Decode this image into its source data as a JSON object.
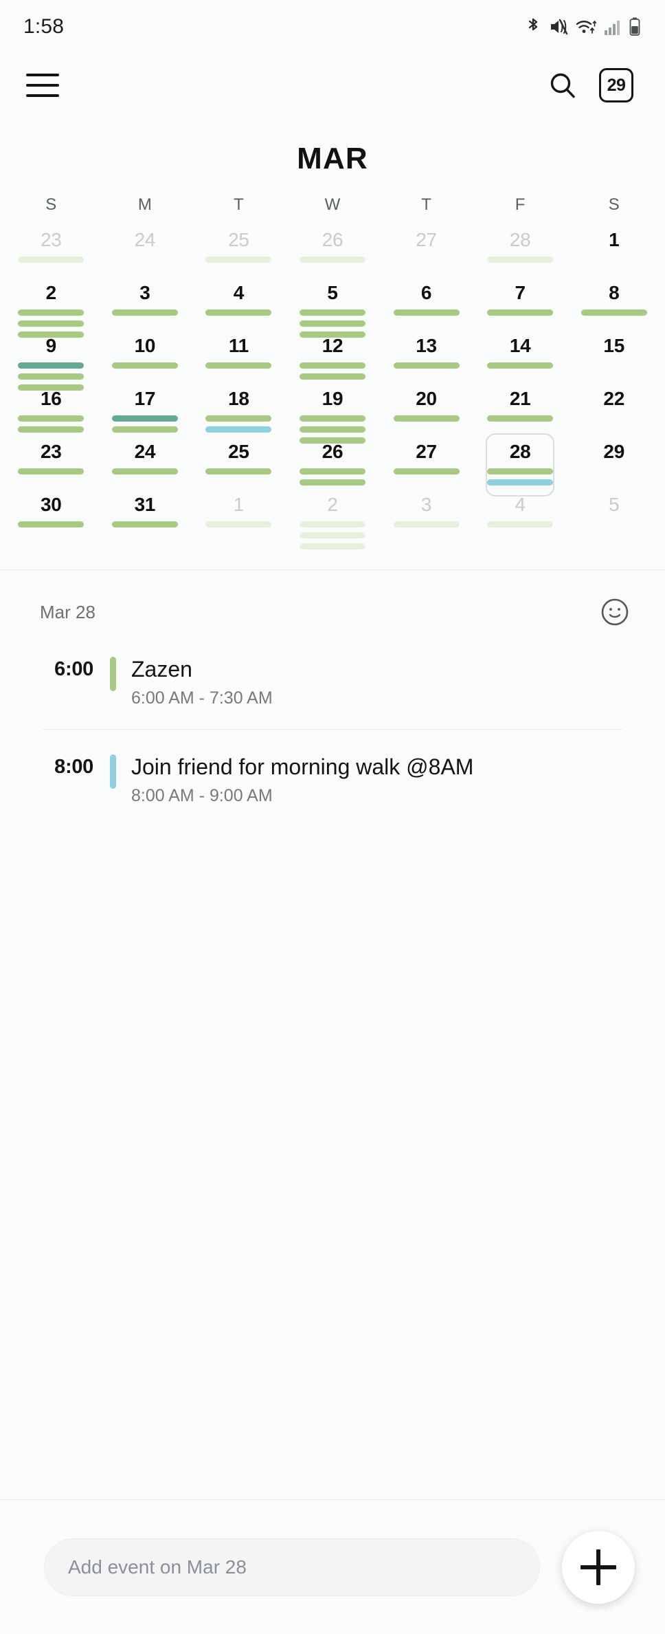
{
  "status": {
    "time": "1:58",
    "icons": [
      "bluetooth-icon",
      "mute-icon",
      "wifi-icon",
      "signal-icon",
      "battery-icon"
    ]
  },
  "toolbar": {
    "menu_label": "menu",
    "search_label": "search",
    "today_badge": "29"
  },
  "header": {
    "month": "MAR"
  },
  "calendar": {
    "weekday_headers": [
      "S",
      "M",
      "T",
      "W",
      "T",
      "F",
      "S"
    ],
    "colors": {
      "green": "#a8c981",
      "teal": "#62ab91",
      "blue": "#8fcfdf",
      "green_faded": "#e7f0dd",
      "selected_border": "#dcdcdc"
    },
    "weeks": [
      [
        {
          "num": "23",
          "other": true,
          "selected": false,
          "bars": [
            "green_faded"
          ]
        },
        {
          "num": "24",
          "other": true,
          "selected": false,
          "bars": []
        },
        {
          "num": "25",
          "other": true,
          "selected": false,
          "bars": [
            "green_faded"
          ]
        },
        {
          "num": "26",
          "other": true,
          "selected": false,
          "bars": [
            "green_faded"
          ]
        },
        {
          "num": "27",
          "other": true,
          "selected": false,
          "bars": []
        },
        {
          "num": "28",
          "other": true,
          "selected": false,
          "bars": [
            "green_faded"
          ]
        },
        {
          "num": "1",
          "other": false,
          "selected": false,
          "bars": []
        }
      ],
      [
        {
          "num": "2",
          "other": false,
          "selected": false,
          "bars": [
            "green",
            "green",
            "green"
          ]
        },
        {
          "num": "3",
          "other": false,
          "selected": false,
          "bars": [
            "green"
          ]
        },
        {
          "num": "4",
          "other": false,
          "selected": false,
          "bars": [
            "green"
          ]
        },
        {
          "num": "5",
          "other": false,
          "selected": false,
          "bars": [
            "green",
            "green",
            "green"
          ]
        },
        {
          "num": "6",
          "other": false,
          "selected": false,
          "bars": [
            "green"
          ]
        },
        {
          "num": "7",
          "other": false,
          "selected": false,
          "bars": [
            "green"
          ]
        },
        {
          "num": "8",
          "other": false,
          "selected": false,
          "bars": [
            "green"
          ]
        }
      ],
      [
        {
          "num": "9",
          "other": false,
          "selected": false,
          "bars": [
            "teal",
            "green",
            "green"
          ]
        },
        {
          "num": "10",
          "other": false,
          "selected": false,
          "bars": [
            "green"
          ]
        },
        {
          "num": "11",
          "other": false,
          "selected": false,
          "bars": [
            "green"
          ]
        },
        {
          "num": "12",
          "other": false,
          "selected": false,
          "bars": [
            "green",
            "green"
          ]
        },
        {
          "num": "13",
          "other": false,
          "selected": false,
          "bars": [
            "green"
          ]
        },
        {
          "num": "14",
          "other": false,
          "selected": false,
          "bars": [
            "green"
          ]
        },
        {
          "num": "15",
          "other": false,
          "selected": false,
          "bars": []
        }
      ],
      [
        {
          "num": "16",
          "other": false,
          "selected": false,
          "bars": [
            "green",
            "green"
          ]
        },
        {
          "num": "17",
          "other": false,
          "selected": false,
          "bars": [
            "teal",
            "green"
          ]
        },
        {
          "num": "18",
          "other": false,
          "selected": false,
          "bars": [
            "green",
            "blue"
          ]
        },
        {
          "num": "19",
          "other": false,
          "selected": false,
          "bars": [
            "green",
            "green",
            "green"
          ]
        },
        {
          "num": "20",
          "other": false,
          "selected": false,
          "bars": [
            "green"
          ]
        },
        {
          "num": "21",
          "other": false,
          "selected": false,
          "bars": [
            "green"
          ]
        },
        {
          "num": "22",
          "other": false,
          "selected": false,
          "bars": []
        }
      ],
      [
        {
          "num": "23",
          "other": false,
          "selected": false,
          "bars": [
            "green"
          ]
        },
        {
          "num": "24",
          "other": false,
          "selected": false,
          "bars": [
            "green"
          ]
        },
        {
          "num": "25",
          "other": false,
          "selected": false,
          "bars": [
            "green"
          ]
        },
        {
          "num": "26",
          "other": false,
          "selected": false,
          "bars": [
            "green",
            "green"
          ]
        },
        {
          "num": "27",
          "other": false,
          "selected": false,
          "bars": [
            "green"
          ]
        },
        {
          "num": "28",
          "other": false,
          "selected": true,
          "bars": [
            "green",
            "blue"
          ]
        },
        {
          "num": "29",
          "other": false,
          "selected": false,
          "bars": []
        }
      ],
      [
        {
          "num": "30",
          "other": false,
          "selected": false,
          "bars": [
            "green"
          ]
        },
        {
          "num": "31",
          "other": false,
          "selected": false,
          "bars": [
            "green"
          ]
        },
        {
          "num": "1",
          "other": true,
          "selected": false,
          "bars": [
            "green_faded"
          ]
        },
        {
          "num": "2",
          "other": true,
          "selected": false,
          "bars": [
            "green_faded",
            "green_faded",
            "green_faded"
          ]
        },
        {
          "num": "3",
          "other": true,
          "selected": false,
          "bars": [
            "green_faded"
          ]
        },
        {
          "num": "4",
          "other": true,
          "selected": false,
          "bars": [
            "green_faded"
          ]
        },
        {
          "num": "5",
          "other": true,
          "selected": false,
          "bars": []
        }
      ]
    ]
  },
  "agenda": {
    "date_label": "Mar 28",
    "mood_icon": "smiley-icon",
    "events": [
      {
        "time": "6:00",
        "title": "Zazen",
        "range": "6:00 AM - 7:30 AM",
        "color": "#a8c981"
      },
      {
        "time": "8:00",
        "title": "Join friend for morning walk @8AM",
        "range": "8:00 AM - 9:00 AM",
        "color": "#8fcfdf"
      }
    ]
  },
  "bottom": {
    "input_placeholder": "Add event on Mar 28",
    "input_value": "",
    "fab_label": "add"
  }
}
